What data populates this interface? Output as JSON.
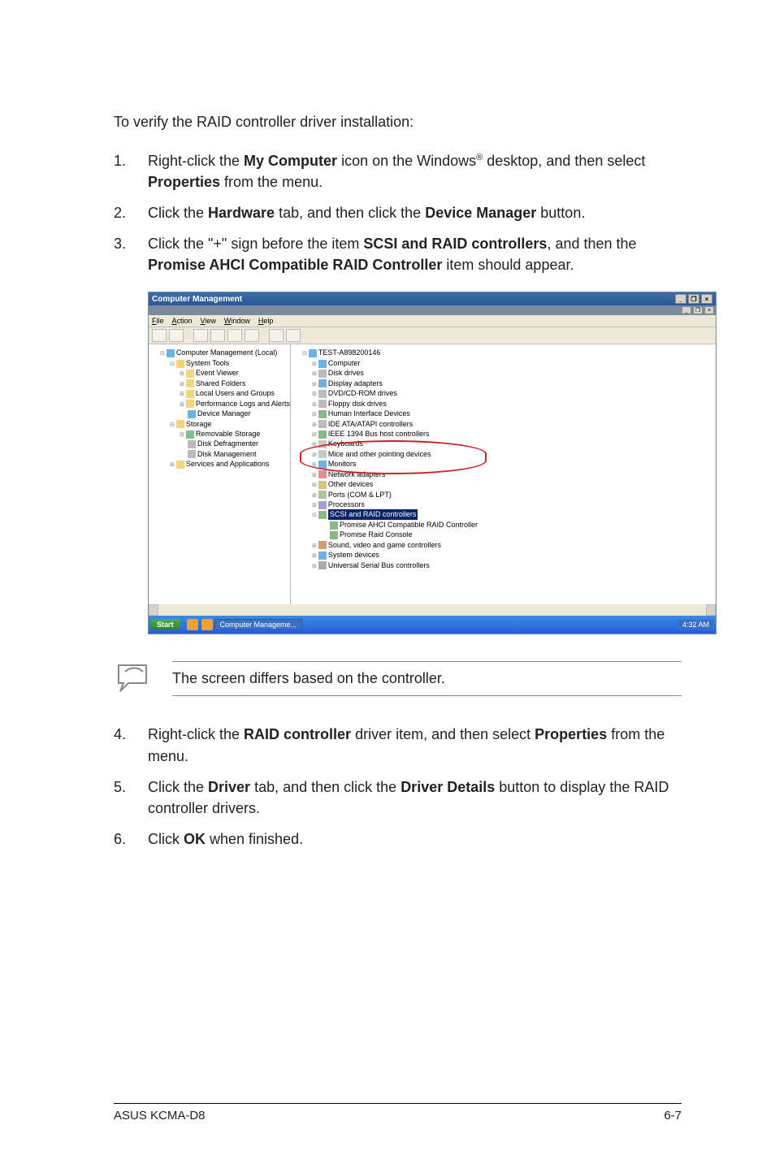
{
  "intro": "To verify the RAID controller driver installation:",
  "steps_top": [
    {
      "num": "1.",
      "pre": "Right-click the ",
      "b1": "My Computer",
      "mid": " icon on the Windows",
      "sup": "®",
      "post": " desktop, and then select ",
      "b2": "Properties",
      "tail": " from the menu."
    },
    {
      "num": "2.",
      "pre": "Click the ",
      "b1": "Hardware",
      "mid": " tab, and then click the ",
      "b2": "Device Manager",
      "tail": " button."
    },
    {
      "num": "3.",
      "pre": "Click the \"+\" sign before the item ",
      "b1": "SCSI and RAID controllers",
      "mid": ", and then the ",
      "b2": "Promise AHCI Compatible RAID Controller",
      "tail": " item should appear."
    }
  ],
  "win": {
    "title": "Computer Management",
    "ctrl_min": "_",
    "ctrl_max": "❐",
    "ctrl_close": "×",
    "menu": [
      "File",
      "Action",
      "View",
      "Window",
      "Help"
    ],
    "left_tree": {
      "root": "Computer Management (Local)",
      "system_tools": "System Tools",
      "st_items": [
        "Event Viewer",
        "Shared Folders",
        "Local Users and Groups",
        "Performance Logs and Alerts",
        "Device Manager"
      ],
      "storage": "Storage",
      "storage_items": [
        "Removable Storage",
        "Disk Defragmenter",
        "Disk Management"
      ],
      "services": "Services and Applications"
    },
    "right_tree": {
      "root": "TEST-A898200146",
      "items": [
        "Computer",
        "Disk drives",
        "Display adapters",
        "DVD/CD-ROM drives",
        "Floppy disk drives",
        "Human Interface Devices",
        "IDE ATA/ATAPI controllers",
        "IEEE 1394 Bus host controllers",
        "Keyboards",
        "Mice and other pointing devices",
        "Monitors",
        "Network adapters",
        "Other devices",
        "Ports (COM & LPT)",
        "Processors"
      ],
      "scsi": "SCSI and RAID controllers",
      "scsi_children": [
        "Promise AHCI Compatible RAID Controller",
        "Promise Raid Console"
      ],
      "after": [
        "Sound, video and game controllers",
        "System devices",
        "Universal Serial Bus controllers"
      ]
    },
    "taskbar": {
      "start": "Start",
      "task": "Computer Manageme...",
      "time": "4:32 AM"
    }
  },
  "note": "The screen differs based on the controller.",
  "steps_bottom": [
    {
      "num": "4.",
      "pre": "Right-click the ",
      "b1": "RAID controller",
      "mid": " driver item, and then select ",
      "b2": "Properties",
      "tail": " from the menu."
    },
    {
      "num": "5.",
      "pre": "Click the ",
      "b1": "Driver",
      "mid": " tab, and then click the ",
      "b2": "Driver Details",
      "tail": " button to display the RAID controller drivers."
    },
    {
      "num": "6.",
      "pre": "Click ",
      "b1": "OK",
      "mid": "",
      "b2": "",
      "tail": " when finished."
    }
  ],
  "footer": {
    "left": "ASUS KCMA-D8",
    "right": "6-7"
  }
}
